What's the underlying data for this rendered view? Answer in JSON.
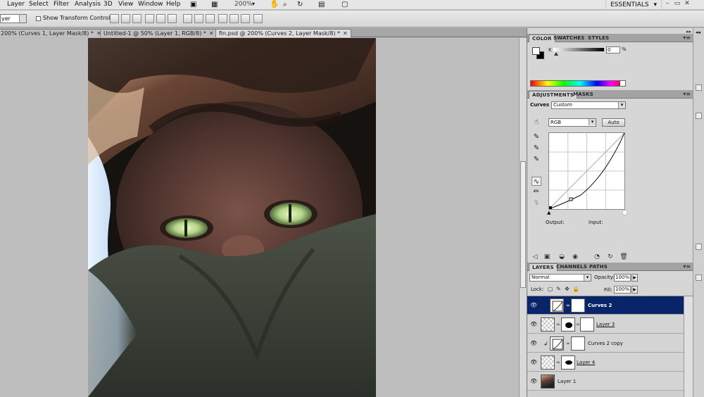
{
  "menubar": {
    "items": [
      "Layer",
      "Select",
      "Filter",
      "Analysis",
      "3D",
      "View",
      "Window",
      "Help"
    ],
    "zoom": "200%",
    "workspace": "ESSENTIALS",
    "window_buttons": [
      "–",
      "▭",
      "✕"
    ]
  },
  "options_bar": {
    "layer_select": "yer",
    "show_transform_label": "Show Transform Controls"
  },
  "tabs": [
    {
      "label": "200% (Curves 1, Layer Mask/8) *"
    },
    {
      "label": "Untitled-1 @ 50% (Layer 1, RGB/8) *"
    },
    {
      "label": "fin.psd @ 200% (Curves 2, Layer Mask/8) *"
    }
  ],
  "color_panel": {
    "tabs": [
      "COLOR",
      "SWATCHES",
      "STYLES"
    ],
    "k_label": "K",
    "k_value": "0",
    "k_unit": "%"
  },
  "adjustments_panel": {
    "tabs": [
      "ADJUSTMENTS",
      "MASKS"
    ],
    "title": "Curves",
    "preset": "Custom",
    "channel": "RGB",
    "auto_label": "Auto",
    "output_label": "Output:",
    "input_label": "Input:"
  },
  "layers_panel": {
    "tabs": [
      "LAYERS",
      "CHANNELS",
      "PATHS"
    ],
    "blend_mode": "Normal",
    "opacity_label": "Opacity:",
    "opacity": "100%",
    "lock_label": "Lock:",
    "fill_label": "Fill:",
    "fill": "100%",
    "layers": [
      {
        "name": "Curves 2",
        "selected": true
      },
      {
        "name": "Layer 3",
        "selected": false
      },
      {
        "name": "Curves 2 copy",
        "selected": false
      },
      {
        "name": "Layer 4",
        "selected": false
      },
      {
        "name": "Layer 1",
        "selected": false
      }
    ]
  }
}
